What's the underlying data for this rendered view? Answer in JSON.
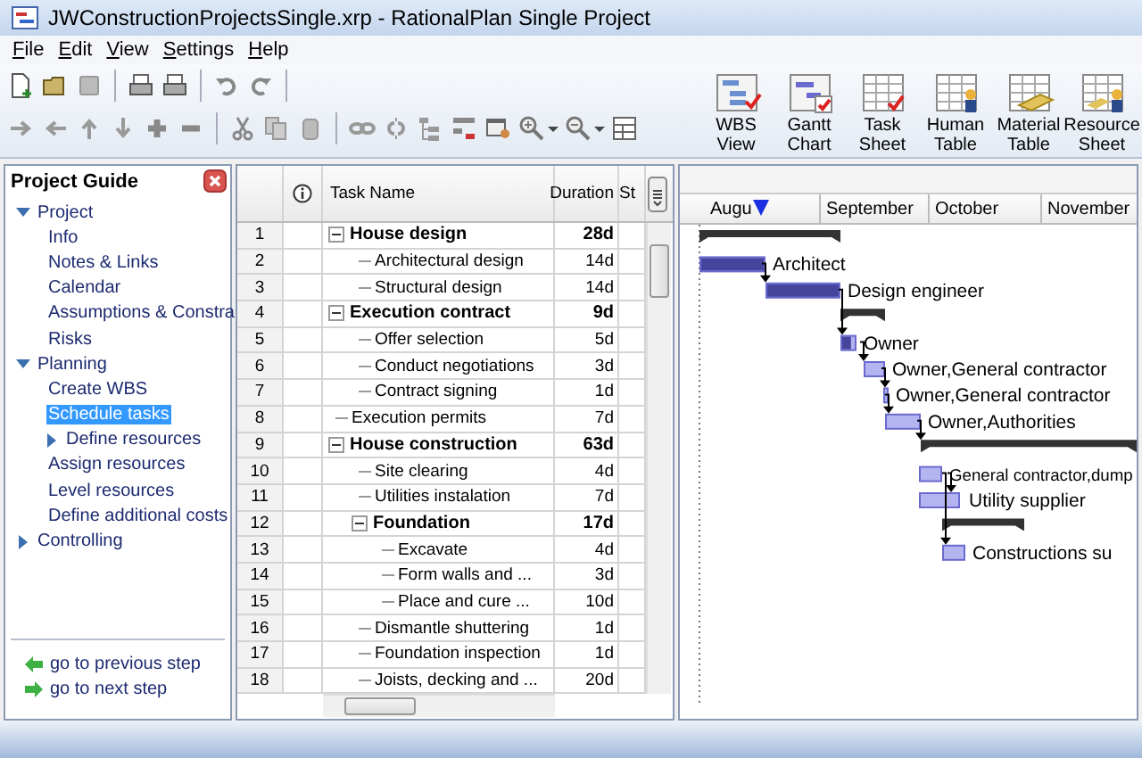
{
  "window": {
    "title": "JWConstructionProjectsSingle.xrp - RationalPlan Single Project"
  },
  "menu": [
    "File",
    "Edit",
    "View",
    "Settings",
    "Help"
  ],
  "view_buttons": [
    {
      "label": "WBS View",
      "kind": "tree"
    },
    {
      "label": "Gantt Chart",
      "kind": "gantt"
    },
    {
      "label": "Task Sheet",
      "kind": "sheet"
    },
    {
      "label": "Human Table",
      "kind": "human"
    },
    {
      "label": "Material Table",
      "kind": "material"
    },
    {
      "label": "Resource Sheet",
      "kind": "resource"
    }
  ],
  "guide": {
    "title": "Project Guide",
    "items": [
      {
        "label": "Project",
        "expanded": true,
        "selected": false,
        "children": [
          {
            "label": "Info",
            "selected": false
          },
          {
            "label": "Notes & Links",
            "selected": false
          },
          {
            "label": "Calendar",
            "selected": false
          },
          {
            "label": "Assumptions & Constra",
            "selected": false
          },
          {
            "label": "Risks",
            "selected": false
          }
        ]
      },
      {
        "label": "Planning",
        "expanded": true,
        "selected": false,
        "children": [
          {
            "label": "Create WBS",
            "selected": false
          },
          {
            "label": "Schedule tasks",
            "selected": true
          },
          {
            "label": "Define resources",
            "expanded": false,
            "selected": false
          },
          {
            "label": "Assign resources",
            "selected": false
          },
          {
            "label": "Level resources",
            "selected": false
          },
          {
            "label": "Define additional costs",
            "selected": false
          }
        ]
      },
      {
        "label": "Controlling",
        "expanded": false,
        "selected": false
      }
    ],
    "footer": [
      "go to previous step",
      "go to next step"
    ]
  },
  "table": {
    "columns": [
      "Task Name",
      "Duration",
      "St"
    ],
    "rows": [
      {
        "number": "1",
        "name": "House design",
        "duration": "28d",
        "expanded": true,
        "children": [
          {
            "number": "2",
            "name": "Architectural design",
            "duration": "14d"
          },
          {
            "number": "3",
            "name": "Structural design",
            "duration": "14d"
          }
        ]
      },
      {
        "number": "4",
        "name": "Execution contract",
        "duration": "9d",
        "expanded": true,
        "children": [
          {
            "number": "5",
            "name": "Offer selection",
            "duration": "5d"
          },
          {
            "number": "6",
            "name": "Conduct negotiations",
            "duration": "3d"
          },
          {
            "number": "7",
            "name": "Contract signing",
            "duration": "1d"
          }
        ]
      },
      {
        "number": "8",
        "name": "Execution permits",
        "duration": "7d"
      },
      {
        "number": "9",
        "name": "House construction",
        "duration": "63d",
        "expanded": true,
        "children": [
          {
            "number": "10",
            "name": "Site clearing",
            "duration": "4d"
          },
          {
            "number": "11",
            "name": "Utilities instalation",
            "duration": "7d"
          },
          {
            "number": "12",
            "name": "Foundation",
            "duration": "17d",
            "expanded": true,
            "children": [
              {
                "number": "13",
                "name": "Excavate",
                "duration": "4d"
              },
              {
                "number": "14",
                "name": "Form walls and ...",
                "duration": "3d"
              },
              {
                "number": "15",
                "name": "Place and cure ...",
                "duration": "10d"
              }
            ]
          },
          {
            "number": "16",
            "name": "Dismantle shuttering",
            "duration": "1d"
          },
          {
            "number": "17",
            "name": "Foundation inspection",
            "duration": "1d"
          },
          {
            "number": "18",
            "name": "Joists, decking and ...",
            "duration": "20d"
          }
        ]
      }
    ]
  },
  "gantt": {
    "months": [
      "Augu",
      "September",
      "October",
      "November"
    ],
    "rows": [
      {
        "kind": "summary"
      },
      {
        "kind": "task",
        "label": "Architect",
        "level": 1
      },
      {
        "kind": "task",
        "label": "Design engineer",
        "level": 1
      },
      {
        "kind": "summary"
      },
      {
        "kind": "task",
        "label": "Owner",
        "level": 0.7
      },
      {
        "kind": "task",
        "label": "Owner,General contractor"
      },
      {
        "kind": "task",
        "label": "Owner,General contractor"
      },
      {
        "kind": "task",
        "label": "Owner,Authorities"
      },
      {
        "kind": "summary"
      },
      {
        "kind": "task",
        "label": "General contractor,dump"
      },
      {
        "kind": "task",
        "label": "Utility supplier"
      },
      {
        "kind": "summary"
      },
      {
        "kind": "task",
        "label": "Constructions su"
      }
    ]
  }
}
